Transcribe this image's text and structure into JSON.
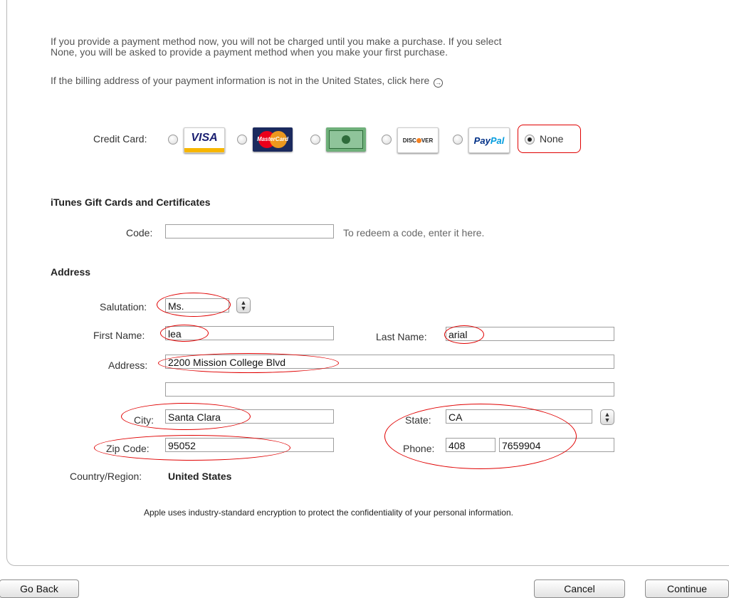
{
  "intro": {
    "line1": "If you provide a payment method now, you will not be charged until you make a purchase. If you select",
    "line2": "None, you will be asked to provide a payment method when you make your first purchase.",
    "billing_text": "If the billing address of your payment information is not in the United States, click here"
  },
  "payment": {
    "label": "Credit Card:",
    "cards": [
      {
        "name": "VISA",
        "color": "#1a1f71"
      },
      {
        "name": "MasterCard",
        "color": "#eb001b"
      },
      {
        "name": "American Express",
        "color": "#2e8b57"
      },
      {
        "name": "DISCOVER",
        "color": "#f68121"
      },
      {
        "name": "PayPal",
        "color": "#003087"
      }
    ],
    "none_label": "None",
    "selected": "None"
  },
  "gift": {
    "heading": "iTunes Gift Cards and Certificates",
    "code_label": "Code:",
    "code_value": "",
    "hint": "To redeem a code, enter it here."
  },
  "address": {
    "heading": "Address",
    "salutation_label": "Salutation:",
    "salutation_value": "Ms.",
    "first_name_label": "First Name:",
    "first_name_value": "lea",
    "last_name_label": "Last Name:",
    "last_name_value": "arial",
    "address_label": "Address:",
    "address_line1": "2200 Mission College Blvd",
    "address_line2": "",
    "city_label": "City:",
    "city_value": "Santa Clara",
    "state_label": "State:",
    "state_value": "CA",
    "zip_label": "Zip Code:",
    "zip_value": "95052",
    "phone_label": "Phone:",
    "phone_area": "408",
    "phone_number": "7659904",
    "country_label": "Country/Region:",
    "country_value": "United States"
  },
  "security_note": "Apple uses industry-standard encryption to protect the confidentiality of your personal information.",
  "buttons": {
    "go_back": "Go Back",
    "cancel": "Cancel",
    "continue": "Continue"
  },
  "colors": {
    "annotation": "#e00000"
  }
}
